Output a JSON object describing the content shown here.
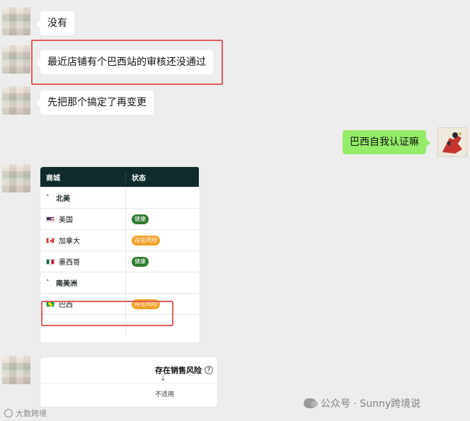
{
  "chat": {
    "messages": [
      {
        "from": "other",
        "text": "没有"
      },
      {
        "from": "other",
        "text": "最近店铺有个巴西站的审核还没通过"
      },
      {
        "from": "other",
        "text": "先把那个搞定了再变更"
      },
      {
        "from": "me",
        "text": "巴西自我认证嘛"
      }
    ]
  },
  "market_table": {
    "headers": [
      "商城",
      "状态"
    ],
    "groups": [
      {
        "name": "北美"
      },
      {
        "name": "南美洲"
      }
    ],
    "rows": [
      {
        "country": "美国",
        "flag_icon": "us-flag-icon",
        "status": "健康"
      },
      {
        "country": "加拿大",
        "flag_icon": "canada-flag-icon",
        "status": "存在风险"
      },
      {
        "country": "墨西哥",
        "flag_icon": "mexico-flag-icon",
        "status": "健康"
      },
      {
        "country": "巴西",
        "flag_icon": "brazil-flag-icon",
        "status": "存在风险"
      }
    ]
  },
  "risk_card": {
    "title": "存在销售风险",
    "sort_mark": "↓",
    "value": "不适用"
  },
  "watermarks": {
    "right": "公众号 · Sunny跨境说",
    "left": "大数跨境"
  },
  "colors": {
    "chat_background": "#ededed",
    "my_bubble": "#95ec69",
    "highlight_box": "#e25b5b",
    "table_header": "#0f2b2b",
    "badge_ok": "#2f7a2f",
    "badge_risk": "#f3a12a"
  }
}
